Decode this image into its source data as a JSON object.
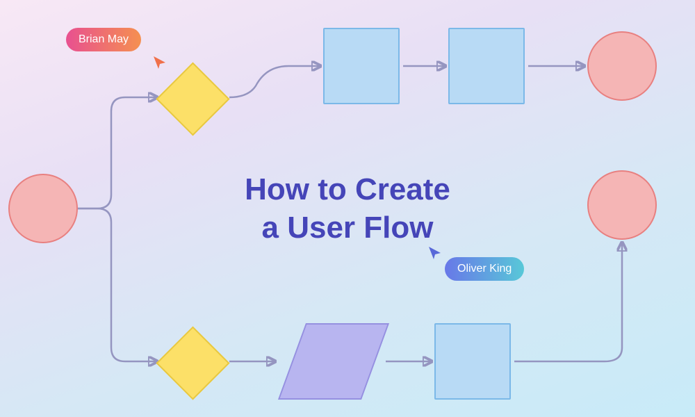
{
  "title": "How to Create\na User Flow",
  "users": {
    "brian": {
      "label": "Brian May"
    },
    "oliver": {
      "label": "Oliver King"
    }
  },
  "colors": {
    "circle_fill": "#f5b5b5",
    "circle_stroke": "#e88080",
    "square_fill": "#b8daf5",
    "square_stroke": "#7bb8e8",
    "diamond_fill": "#fce068",
    "diamond_stroke": "#e8c840",
    "parallelogram_fill": "#b8b5f0",
    "parallelogram_stroke": "#9590e0",
    "connector": "#9595c0",
    "title": "#4545b8"
  },
  "nodes": {
    "start_circle": "circle",
    "top_diamond": "diamond",
    "top_square_1": "square",
    "top_square_2": "square",
    "top_end_circle": "circle",
    "bottom_diamond": "diamond",
    "bottom_parallelogram": "parallelogram",
    "bottom_square": "square",
    "bottom_end_circle": "circle"
  }
}
